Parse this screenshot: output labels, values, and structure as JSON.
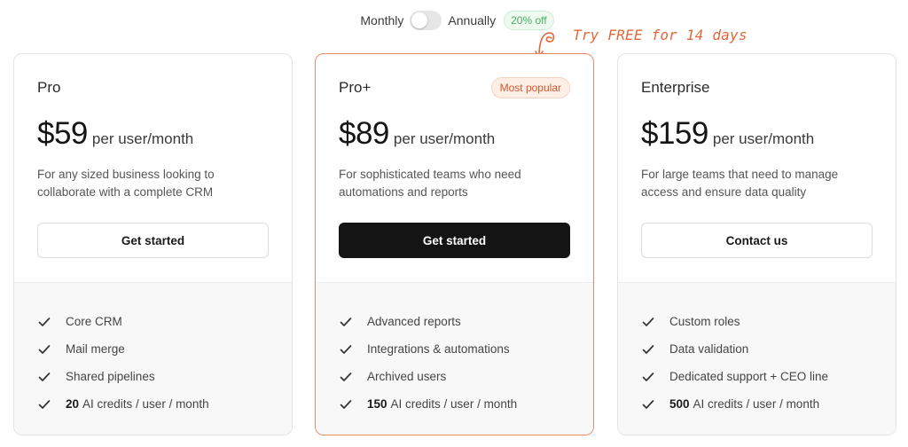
{
  "billing": {
    "monthly_label": "Monthly",
    "annually_label": "Annually",
    "discount_badge": "20% off",
    "selected": "Monthly"
  },
  "annotation": "Try FREE for 14 days",
  "colors": {
    "accent": "#e2673a",
    "featured_border": "#e88c68",
    "primary_button": "#141414",
    "discount_green": "#4cae5f"
  },
  "plans": [
    {
      "name": "Pro",
      "price": "$59",
      "unit": "per user/month",
      "description": "For any sized business looking to collaborate with a complete CRM",
      "cta": "Get started",
      "features": [
        "Core CRM",
        "Mail merge",
        "Shared pipelines"
      ],
      "credits_amount": "20",
      "credits_text": "AI credits / user / month"
    },
    {
      "name": "Pro+",
      "badge": "Most popular",
      "price": "$89",
      "unit": "per user/month",
      "description": "For sophisticated teams who need automations and reports",
      "cta": "Get started",
      "features": [
        "Advanced reports",
        "Integrations & automations",
        "Archived users"
      ],
      "credits_amount": "150",
      "credits_text": "AI credits / user / month"
    },
    {
      "name": "Enterprise",
      "price": "$159",
      "unit": "per user/month",
      "description": "For large teams that need to manage access and ensure data quality",
      "cta": "Contact us",
      "features": [
        "Custom roles",
        "Data validation",
        "Dedicated support + CEO line"
      ],
      "credits_amount": "500",
      "credits_text": "AI credits / user / month"
    }
  ]
}
